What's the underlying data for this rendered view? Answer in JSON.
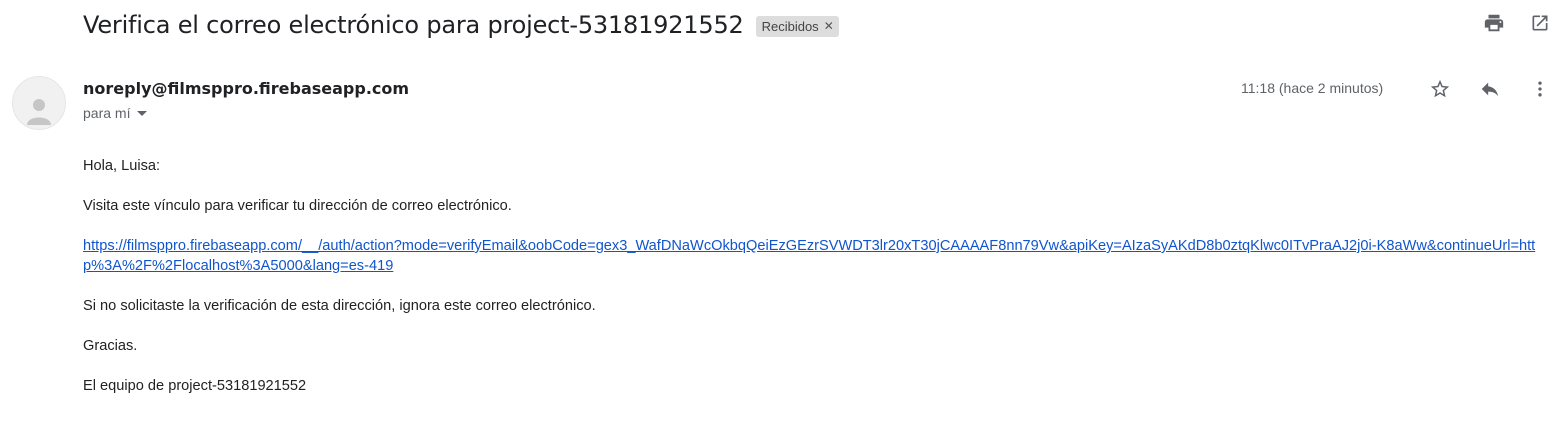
{
  "email": {
    "subject": "Verifica el correo electrónico para project-53181921552",
    "label": "Recibidos",
    "label_remove_icon": "close-icon",
    "sender": "noreply@filmsppro.firebaseapp.com",
    "recipient": "para mí",
    "timestamp": "11:18 (hace 2 minutos)",
    "body": {
      "greeting": "Hola, Luisa:",
      "instruction": "Visita este vínculo para verificar tu dirección de correo electrónico.",
      "link": "https://filmsppro.firebaseapp.com/__/auth/action?mode=verifyEmail&oobCode=gex3_WafDNaWcOkbqQeiEzGEzrSVWDT3lr20xT30jCAAAAF8nn79Vw&apiKey=AIzaSyAKdD8b0ztqKlwc0ITvPraAJ2j0i-K8aWw&continueUrl=http%3A%2F%2Flocalhost%3A5000&lang=es-419",
      "ignore_note": "Si no solicitaste la verificación de esta dirección, ignora este correo electrónico.",
      "thanks": "Gracias.",
      "signature": "El equipo de project-53181921552"
    }
  },
  "icons": {
    "print": "print-icon",
    "open_new_window": "open-in-new-window-icon",
    "avatar": "default-avatar-icon",
    "star": "star-icon",
    "reply": "reply-icon",
    "more": "more-vertical-icon",
    "dropdown": "caret-down-icon"
  },
  "colors": {
    "link": "#1155cc",
    "chip_background": "#dddddd",
    "secondary_text": "#5f6368",
    "icon": "#5f6368"
  }
}
